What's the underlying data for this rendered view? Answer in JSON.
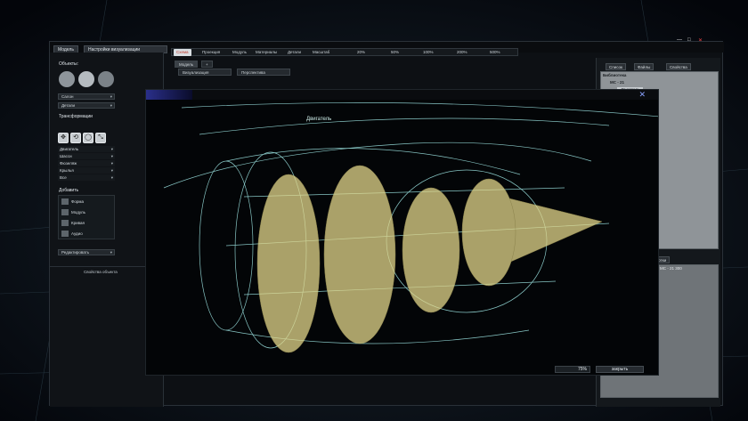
{
  "window": {
    "controls": [
      "—",
      "□",
      "✕"
    ]
  },
  "left_panel": {
    "tabs": [
      "Модель",
      "Настройки визуализации"
    ],
    "objects_title": "Объекты:",
    "dropdowns": [
      "Салон",
      "Детали"
    ],
    "transforms_title": "Трансформации",
    "transform_rows": [
      "Двигатель",
      "Шасси",
      "Фюзеляж",
      "Крылья",
      "Все"
    ],
    "add_title": "Добавить",
    "add_items": [
      "Форма",
      "Модуль",
      "Кривая",
      "Аудио"
    ],
    "bottom_dropdown": "Редактировать",
    "props_label": "Свойства объекта"
  },
  "toolbar": {
    "active": "Схема",
    "items": [
      "Проекция",
      "Модуль",
      "Материалы",
      "Детали",
      "Масштаб",
      "20%",
      "50%",
      "100%",
      "200%",
      "500%"
    ]
  },
  "model_panel": {
    "tabs": [
      "Модель",
      "+"
    ],
    "subtabs": [
      "Визуализация",
      "Перспектива"
    ]
  },
  "right_panel": {
    "tabs": [
      "Список",
      "Файлы",
      "Свойства"
    ],
    "tree": [
      "Библиотека",
      "МС - 21",
      "Двигатель"
    ],
    "tabs2": [
      "Детали",
      "Доработки"
    ],
    "props_rows": [
      "МС - 21",
      "МС - 21 300"
    ]
  },
  "viewport": {
    "label": "Двигатель",
    "close_symbol": "✕",
    "zoom": "75%",
    "close_label": "закрыть"
  },
  "colors": {
    "wireframe": "#9fe8e6",
    "blades": "#e2d68a",
    "accent": "#c0392b"
  }
}
